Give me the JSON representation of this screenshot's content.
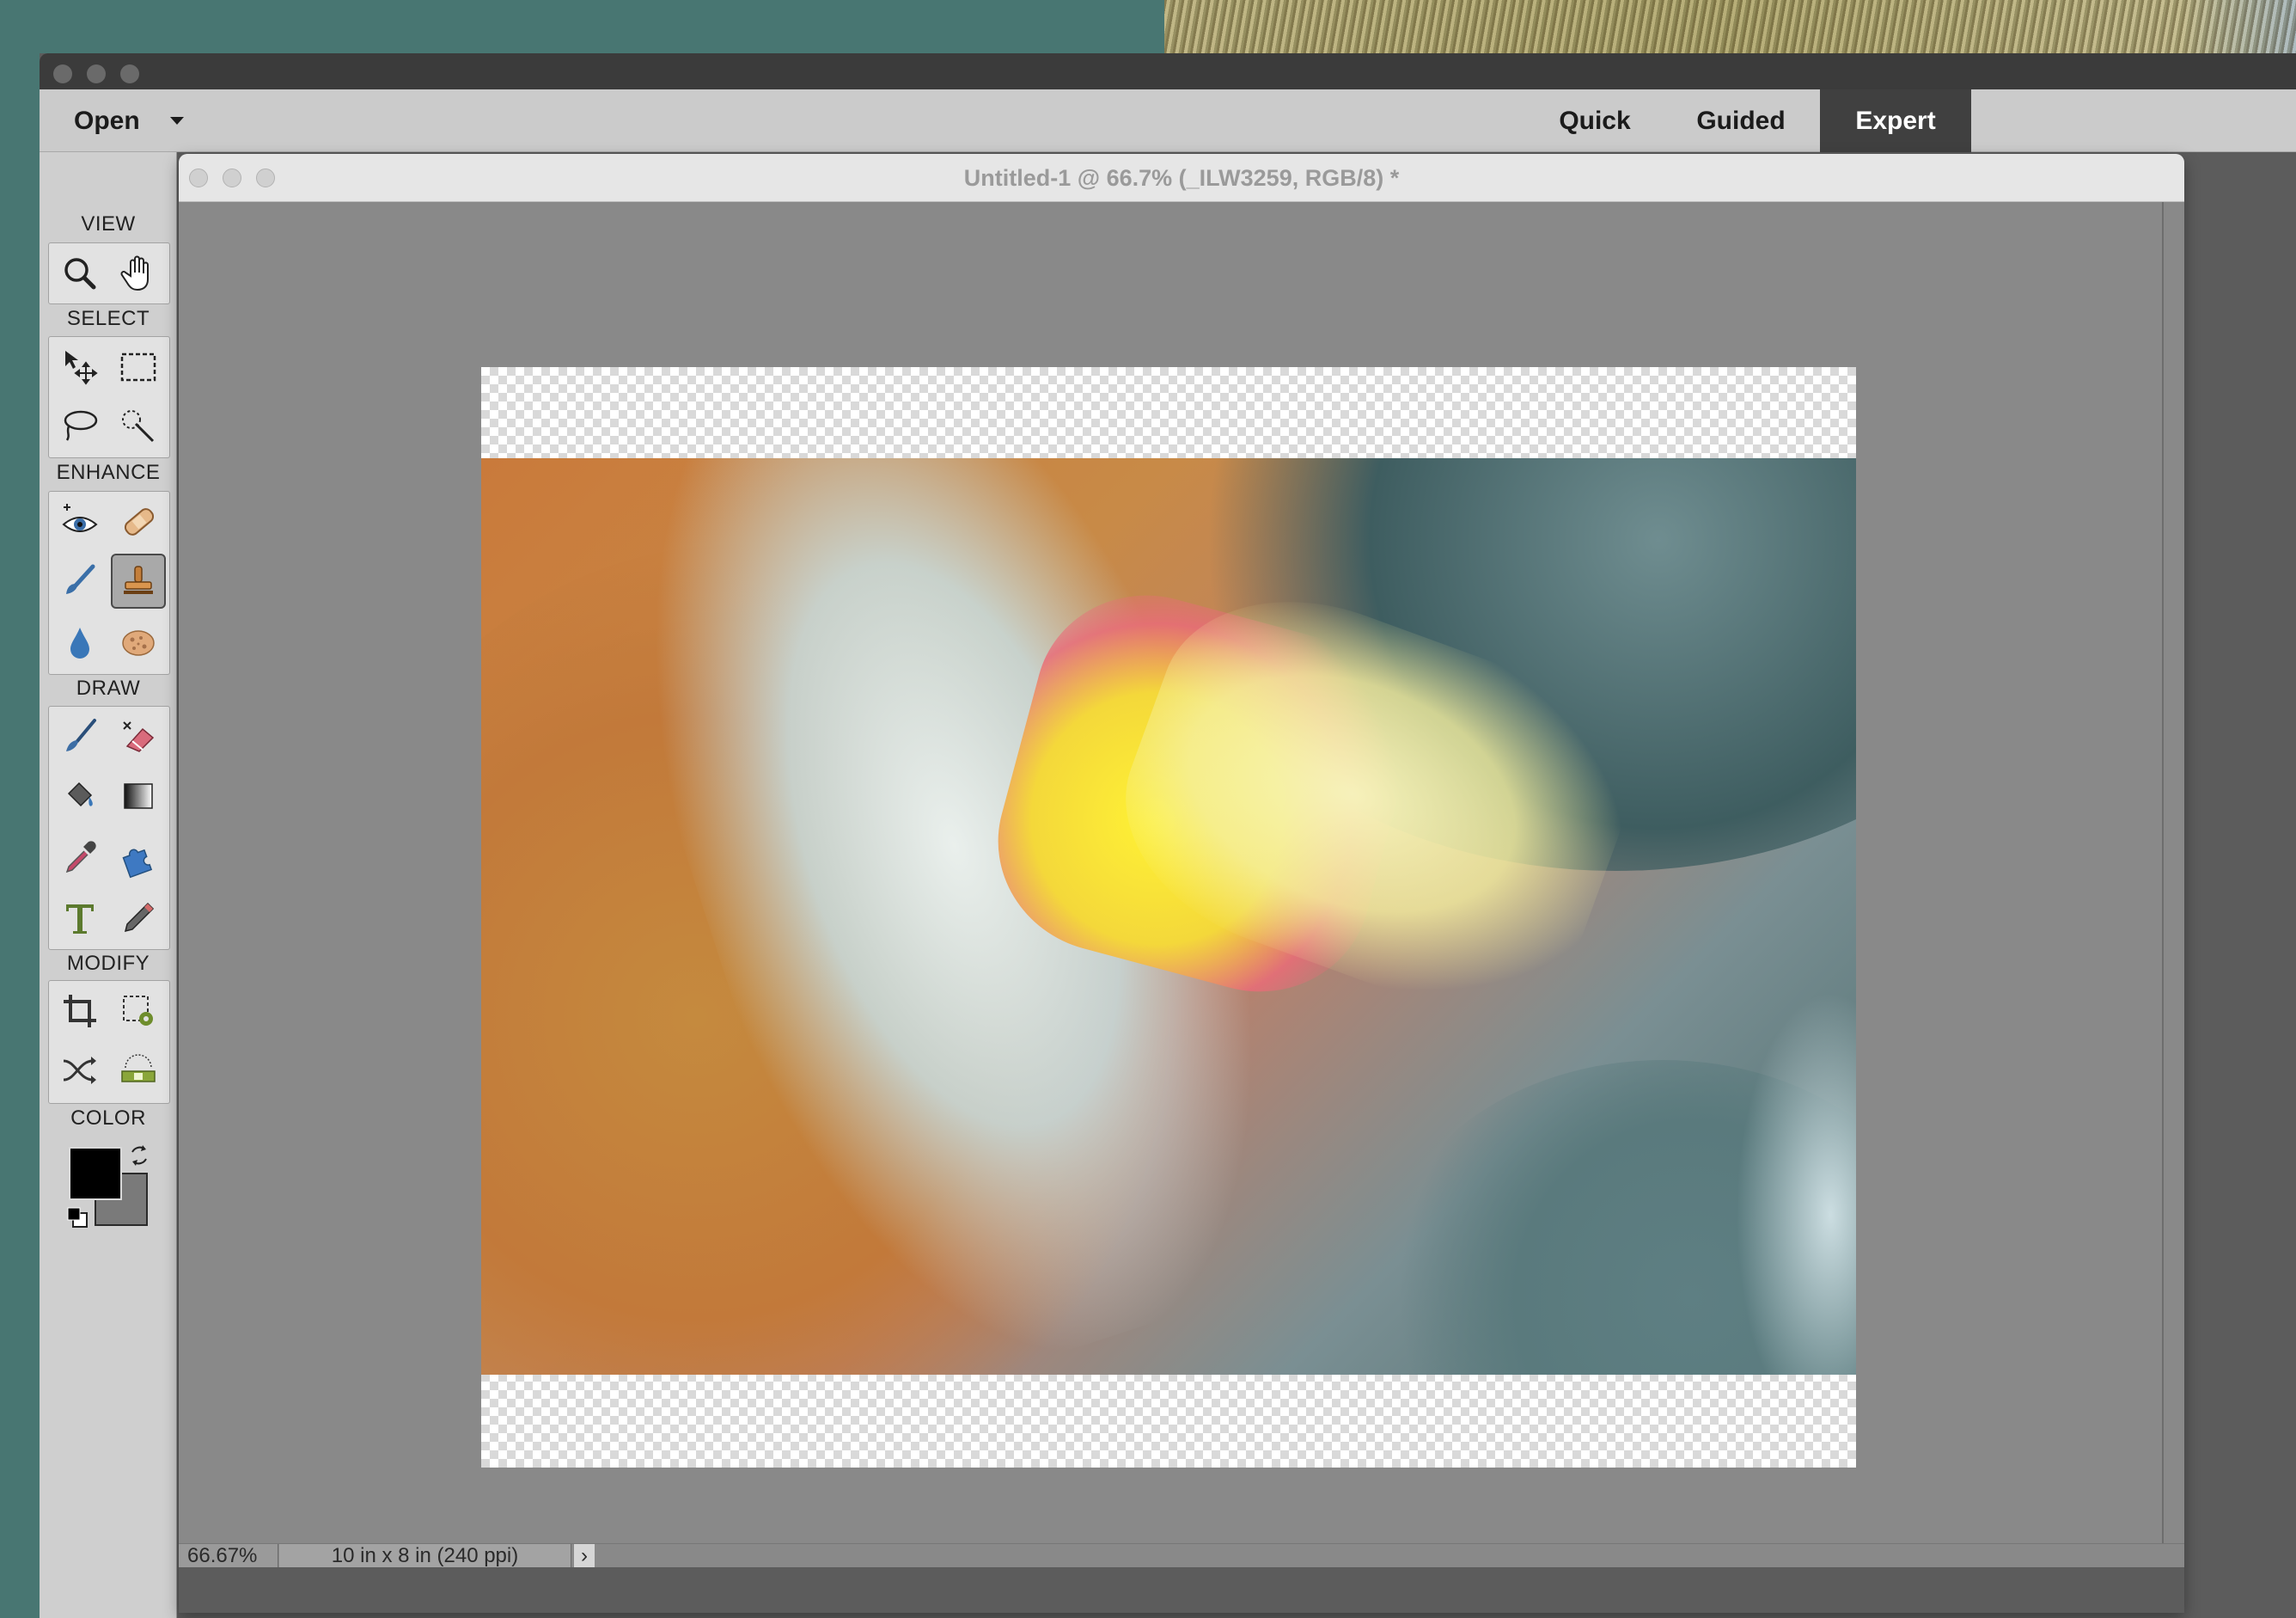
{
  "menubar": {
    "open_label": "Open",
    "modes": [
      "Quick",
      "Guided",
      "Expert"
    ],
    "active_mode": "Expert"
  },
  "toolbox": {
    "sections": {
      "view": "VIEW",
      "select": "SELECT",
      "enhance": "ENHANCE",
      "draw": "DRAW",
      "modify": "MODIFY",
      "color": "COLOR"
    },
    "selected_tool": "clone-stamp-tool",
    "colors": {
      "foreground": "#000000",
      "background": "#7a7a7a"
    }
  },
  "document": {
    "title": "Untitled-1 @ 66.7% (_ILW3259, RGB/8) *",
    "zoom": "66.67%",
    "doc_info": "10 in x 8 in (240 ppi)",
    "info_arrow": "›"
  }
}
